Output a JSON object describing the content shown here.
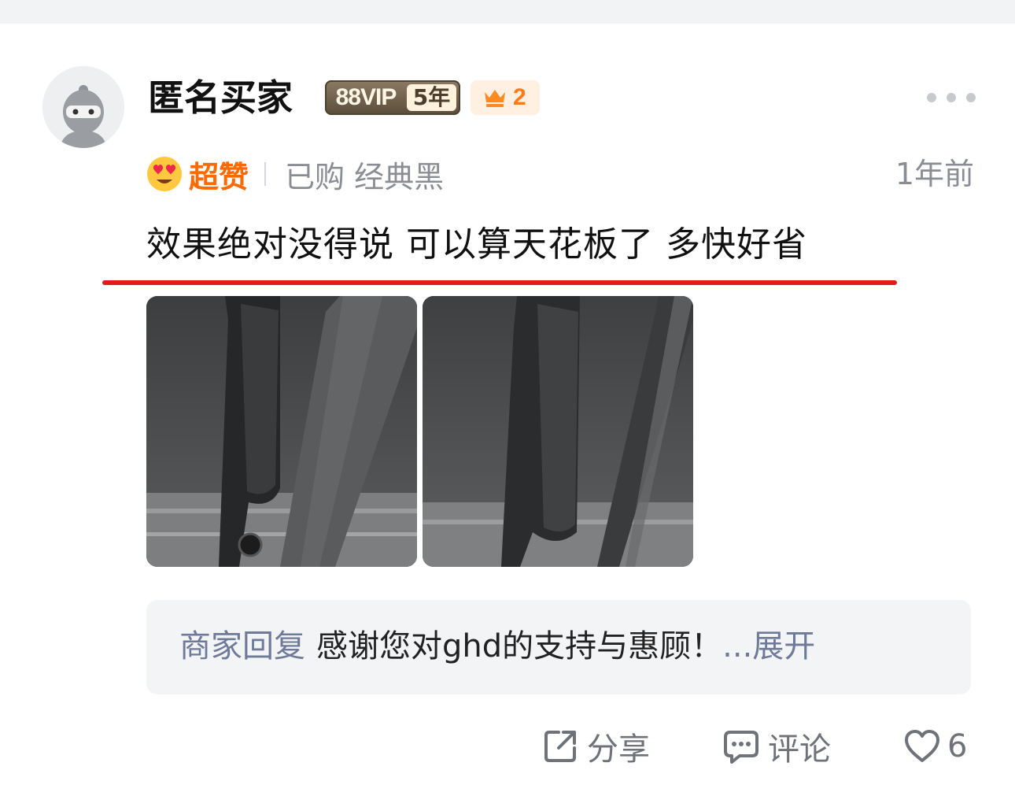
{
  "user": {
    "name": "匿名买家",
    "vip_text": "88VIP",
    "vip_years": "5年",
    "level": "2"
  },
  "review": {
    "rating_label": "超赞",
    "purchase_info": "已购 经典黑",
    "time_ago": "1年前",
    "text": "效果绝对没得说 可以算天花板了 多快好省"
  },
  "photos": [
    {
      "icon": "review-photo"
    },
    {
      "icon": "review-photo"
    }
  ],
  "merchant_reply": {
    "label": "商家回复",
    "text": "感谢您对ghd的支持与惠顾！",
    "expand": "...展开"
  },
  "actions": {
    "share": "分享",
    "comment": "评论",
    "likes": "6"
  },
  "colors": {
    "accent_orange": "#ff6a00",
    "highlight_red": "#e11a1a",
    "reply_label": "#6e7a97"
  }
}
